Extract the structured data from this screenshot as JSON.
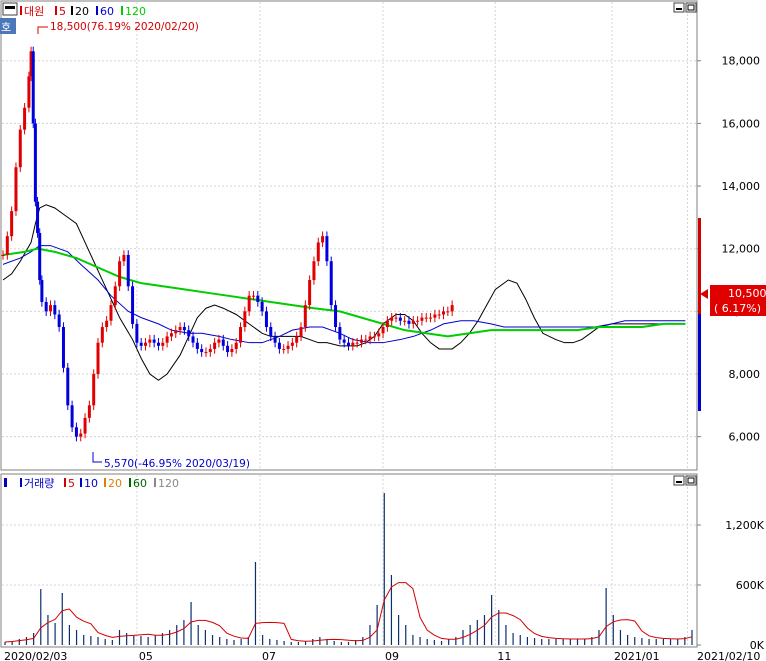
{
  "price_panel": {
    "legend": [
      {
        "label": "대원",
        "color": "#d40000"
      },
      {
        "label": "5",
        "color": "#d40000"
      },
      {
        "label": "20",
        "color": "#000000"
      },
      {
        "label": "60",
        "color": "#0000cc"
      },
      {
        "label": "120",
        "color": "#00cc00"
      }
    ],
    "high_annotation": "18,500(76.19% 2020/02/20)",
    "low_annotation": "5,570(-46.95% 2020/03/19)",
    "current_price": "10,500",
    "current_change": "( 6.17%)",
    "side_label": "호"
  },
  "volume_panel": {
    "legend": [
      {
        "label": "거래량",
        "color": "#0000cc"
      },
      {
        "label": "5",
        "color": "#d40000"
      },
      {
        "label": "10",
        "color": "#0000cc"
      },
      {
        "label": "20",
        "color": "#e08000"
      },
      {
        "label": "60",
        "color": "#006600"
      },
      {
        "label": "120",
        "color": "#888888"
      }
    ]
  },
  "x_labels": [
    {
      "label": "2020/02/03",
      "x": 0
    },
    {
      "label": "05",
      "x": 62
    },
    {
      "label": "07",
      "x": 119
    },
    {
      "label": "09",
      "x": 176
    },
    {
      "label": "11",
      "x": 228
    },
    {
      "label": "2021/01",
      "x": 282
    },
    {
      "label": "2021/02/10",
      "x": 317
    }
  ],
  "chart_data": [
    {
      "type": "candlestick",
      "title": "대원",
      "ylim": [
        5000,
        19300
      ],
      "y_ticks": [
        "6,000",
        "8,000",
        "10,000",
        "12,000",
        "14,000",
        "16,000",
        "18,000"
      ],
      "y_tick_values": [
        6000,
        8000,
        10000,
        12000,
        14000,
        16000,
        18000
      ],
      "x": [
        0,
        2,
        4,
        6,
        8,
        10,
        12,
        13,
        14,
        15,
        16,
        17,
        18,
        20,
        22,
        24,
        26,
        28,
        30,
        32,
        34,
        36,
        38,
        40,
        42,
        44,
        46,
        48,
        50,
        52,
        54,
        56,
        58,
        60,
        62,
        64,
        66,
        68,
        70,
        72,
        74,
        76,
        78,
        80,
        82,
        84,
        86,
        88,
        90,
        92,
        94,
        96,
        98,
        100,
        102,
        104,
        106,
        108,
        110,
        112,
        114,
        116,
        118,
        120,
        122,
        124,
        126,
        128,
        130,
        132,
        134,
        136,
        138,
        140,
        142,
        144,
        146,
        148,
        150,
        152,
        154,
        156,
        158,
        160,
        162,
        164,
        166,
        168,
        170,
        172,
        174,
        176,
        178,
        180,
        182,
        184,
        186,
        188,
        190,
        192,
        194,
        196,
        198,
        200,
        202,
        204,
        206,
        208,
        210,
        212,
        214,
        216,
        218,
        220,
        222,
        224,
        226,
        228,
        230,
        232,
        234,
        236,
        238,
        240,
        242,
        244,
        246,
        248,
        250,
        252,
        254,
        256,
        258,
        260,
        262,
        264,
        266,
        268,
        270,
        272,
        274,
        276,
        278,
        280,
        282,
        284,
        286,
        288,
        290,
        292,
        294,
        296,
        298,
        300,
        302,
        304,
        306,
        308,
        310,
        312,
        314,
        316
      ],
      "series": [
        {
          "name": "5",
          "color": "#d40000",
          "y": [
            11800,
            12400,
            13200,
            14600,
            15800,
            16500,
            17500,
            18300,
            16000,
            13500,
            12500,
            11000,
            10300,
            10000,
            10200,
            9900,
            9500,
            8200,
            7000,
            6300,
            6000,
            6100,
            6600,
            7000,
            8000,
            9000,
            9500,
            9700,
            10200,
            10800,
            11600,
            11800,
            10800,
            9600,
            9000,
            8900,
            9000,
            9100,
            9000,
            8900,
            9000,
            9200,
            9300,
            9400,
            9500,
            9400,
            9200,
            9000,
            8800,
            8700,
            8700,
            8800,
            9000,
            9100,
            8900,
            8700,
            8800,
            9000,
            9500,
            10000,
            10500,
            10500,
            10300,
            10000,
            9500,
            9200,
            9000,
            8800,
            8800,
            8900,
            9000,
            9200,
            9500,
            10200,
            11000,
            11600,
            12200,
            12400,
            11600,
            10200,
            9500,
            9100,
            9000,
            8900,
            9000,
            9000,
            9100,
            9100,
            9200,
            9200,
            9300,
            9500,
            9700,
            9800,
            9800,
            9700,
            9700,
            9600,
            9700,
            9700,
            9800,
            9800,
            9800,
            9900,
            9900,
            10000,
            10000,
            10200
          ]
        },
        {
          "name": "20",
          "color": "#000000",
          "y": [
            11000,
            11200,
            11600,
            12200,
            12800,
            13300,
            13400,
            13300,
            13100,
            12800,
            12200,
            11600,
            11000,
            10400,
            9800,
            9100,
            8500,
            8000,
            7800,
            8000,
            8600,
            9200,
            9800,
            10100,
            10200,
            10100,
            9900,
            9700,
            9500,
            9300,
            9200,
            9200,
            9200,
            9200,
            9100,
            9000,
            9000,
            8900,
            8900,
            8900,
            9000,
            9200,
            9600,
            9900,
            9900,
            9700,
            9300,
            9000,
            8800,
            8800,
            9000,
            9300,
            9700,
            10200,
            10700,
            11000,
            10900,
            10400,
            9800,
            9300,
            9100,
            9000,
            9000,
            9100,
            9300,
            9500,
            9600,
            9600,
            9600,
            9600,
            9600,
            9600,
            9600,
            9600,
            9600
          ]
        },
        {
          "name": "60",
          "color": "#0000cc",
          "y": [
            11500,
            11700,
            11900,
            12100,
            12100,
            11900,
            11500,
            11000,
            10500,
            10000,
            9800,
            9600,
            9400,
            9300,
            9300,
            9200,
            9100,
            9000,
            9000,
            9200,
            9400,
            9500,
            9500,
            9300,
            9100,
            9000,
            9000,
            9100,
            9200,
            9400,
            9600,
            9700,
            9700,
            9600,
            9500,
            9500,
            9500,
            9500,
            9500,
            9500,
            9500,
            9600,
            9700,
            9700,
            9700,
            9700,
            9700
          ]
        },
        {
          "name": "120",
          "color": "#00cc00",
          "y": [
            11800,
            11900,
            12000,
            11900,
            11700,
            11400,
            11100,
            10900,
            10800,
            10700,
            10600,
            10500,
            10400,
            10300,
            10200,
            10100,
            10000,
            9800,
            9600,
            9400,
            9300,
            9200,
            9300,
            9400,
            9400,
            9400,
            9400,
            9400,
            9500,
            9500,
            9500,
            9600,
            9600
          ]
        }
      ]
    },
    {
      "type": "bar",
      "title": "거래량",
      "ylim": [
        0,
        1550000
      ],
      "y_ticks": [
        "0K",
        "600K",
        "1,200K"
      ],
      "y_tick_values": [
        0,
        600000,
        1200000
      ],
      "series": [
        {
          "name": "거래량",
          "color": "#0000cc",
          "values": [
            30000,
            40000,
            60000,
            80000,
            120000,
            560000,
            300000,
            220000,
            520000,
            200000,
            150000,
            100000,
            90000,
            80000,
            60000,
            50000,
            150000,
            120000,
            100000,
            90000,
            80000,
            100000,
            120000,
            150000,
            200000,
            250000,
            430000,
            200000,
            150000,
            100000,
            80000,
            60000,
            50000,
            60000,
            80000,
            830000,
            100000,
            60000,
            50000,
            40000,
            30000,
            30000,
            40000,
            60000,
            80000,
            60000,
            40000,
            30000,
            30000,
            50000,
            80000,
            200000,
            400000,
            1520000,
            700000,
            300000,
            200000,
            100000,
            80000,
            60000,
            50000,
            40000,
            60000,
            80000,
            150000,
            200000,
            250000,
            300000,
            500000,
            350000,
            200000,
            120000,
            100000,
            80000,
            70000,
            60000,
            60000,
            60000,
            60000,
            60000,
            60000,
            60000,
            80000,
            150000,
            570000,
            300000,
            150000,
            100000,
            80000,
            70000,
            60000,
            60000,
            60000,
            60000,
            60000,
            80000,
            150000
          ]
        }
      ]
    }
  ]
}
